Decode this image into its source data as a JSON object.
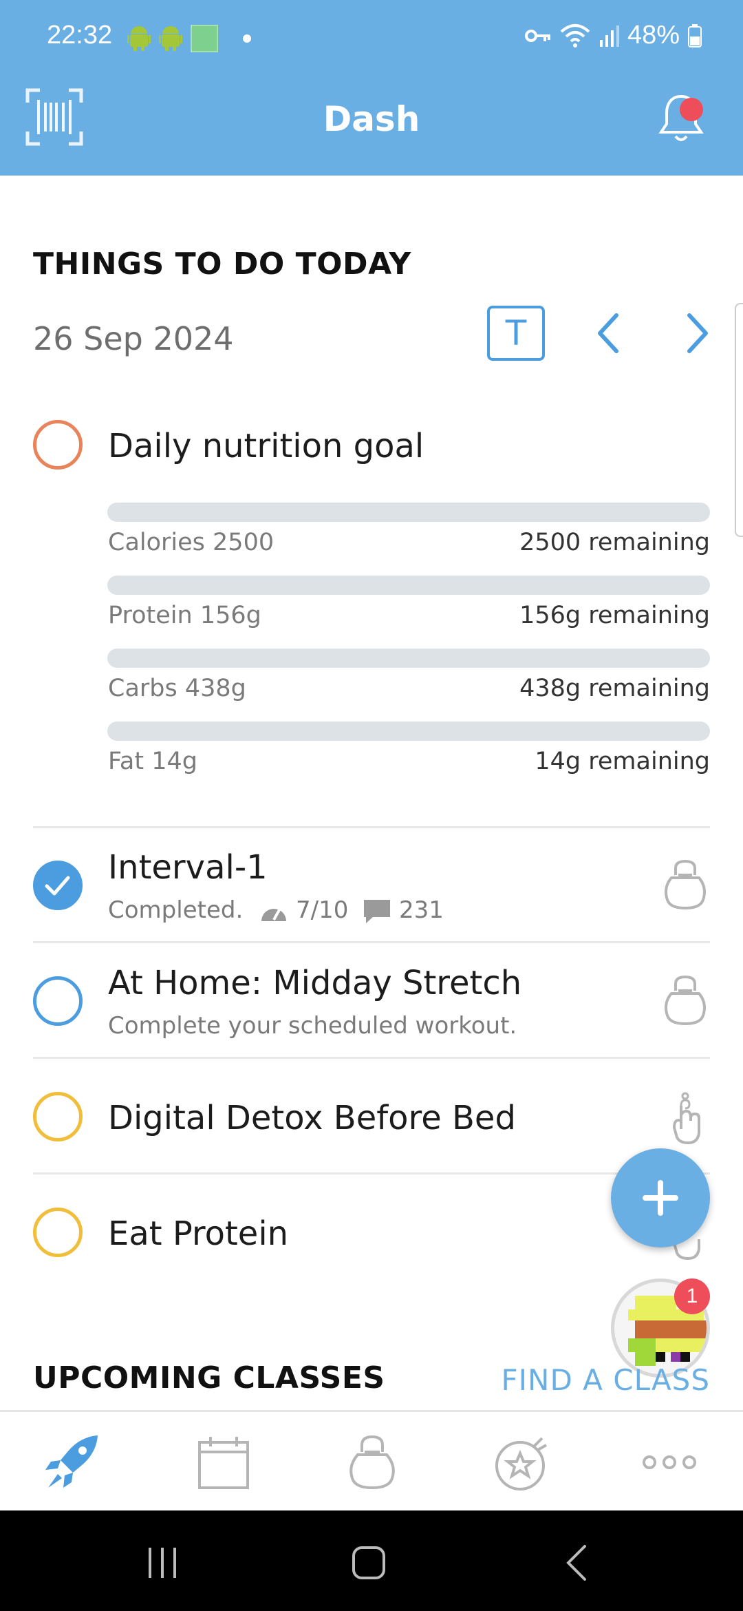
{
  "status_bar": {
    "time": "22:32",
    "battery": "48%",
    "icons": [
      "android-icon",
      "android-icon",
      "gallery-icon",
      "dot-icon",
      "vpn-key-icon",
      "wifi-icon",
      "signal-icon",
      "battery-icon"
    ]
  },
  "header": {
    "title": "Dash",
    "left_icon": "barcode-scan-icon",
    "right_icon": "bell-icon",
    "notification_dot": true
  },
  "today": {
    "section_title": "THINGS TO DO TODAY",
    "date": "26 Sep 2024",
    "today_button": "T"
  },
  "nutrition": {
    "title": "Daily nutrition goal",
    "bars": [
      {
        "label": "Calories 2500",
        "remaining": "2500 remaining",
        "progress": 0
      },
      {
        "label": "Protein 156g",
        "remaining": "156g remaining",
        "progress": 0
      },
      {
        "label": "Carbs 438g",
        "remaining": "438g remaining",
        "progress": 0
      },
      {
        "label": "Fat 14g",
        "remaining": "14g remaining",
        "progress": 0
      }
    ]
  },
  "tasks": [
    {
      "title": "Interval-1",
      "status": "Completed.",
      "rating": "7/10",
      "comments": "231",
      "icon": "kettlebell-icon",
      "checked": true
    },
    {
      "title": "At Home: Midday Stretch",
      "subtitle": "Complete your scheduled workout.",
      "icon": "kettlebell-icon",
      "checked": false
    },
    {
      "title": "Digital Detox Before Bed",
      "icon": "finger-reminder-icon",
      "checked": false
    },
    {
      "title": "Eat Protein",
      "icon": "finger-reminder-icon",
      "checked": false
    }
  ],
  "upcoming": {
    "section_title": "UPCOMING CLASSES",
    "find_class": "FIND A CLASS"
  },
  "avatar_badge": "1",
  "colors": {
    "primary": "#6aafe3",
    "accent_blue": "#4b9de0",
    "orange_ring": "#e8835a",
    "yellow_ring": "#f0be3a",
    "badge_red": "#ee4d5a"
  },
  "bottom_nav": [
    "rocket-icon",
    "calendar-icon",
    "kettlebell-icon",
    "star-badge-icon",
    "more-icon"
  ]
}
